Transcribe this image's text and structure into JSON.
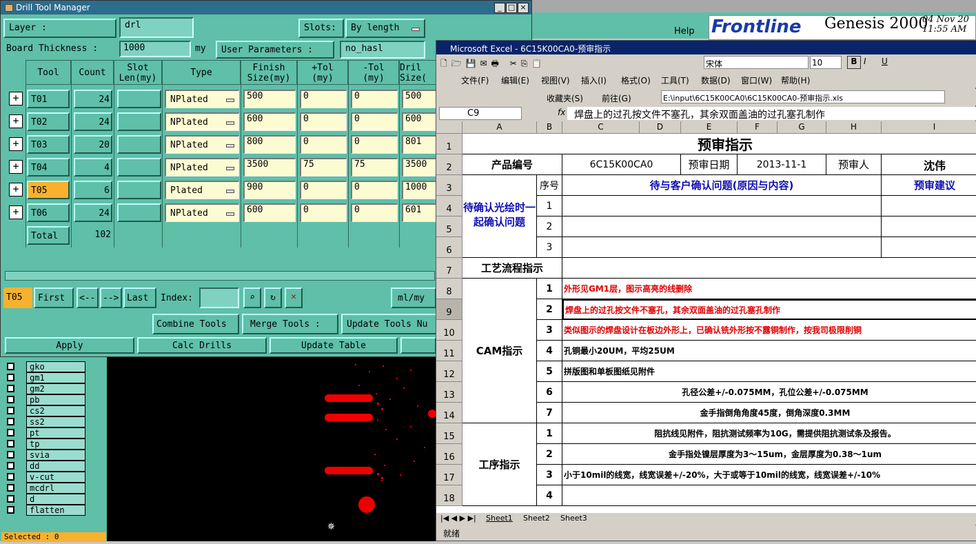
{
  "genesis": {
    "help": "Help",
    "brand": "Frontline",
    "product": "Genesis 2000",
    "date": "04 Nov 20",
    "time": "11:55 AM"
  },
  "drill": {
    "title": "Drill Tool Manager",
    "layer_label": "Layer           :",
    "layer_value": "drl",
    "slots_label": "Slots:",
    "slots_value": "By length",
    "board_label": "Board Thickness :",
    "board_value": "1000",
    "board_unit": "my",
    "userparam_label": "User Parameters :",
    "userparam_value": "no_hasl",
    "headers": [
      "Tool",
      "Count",
      "Slot\nLen(my)",
      "Type",
      "Finish\nSize(my)",
      "+Tol\n(my)",
      "-Tol\n(my)",
      "Dril\nSize("
    ],
    "rows": [
      {
        "tool": "T01",
        "count": "24",
        "type": "NPlated",
        "finish": "500",
        "ptol": "0",
        "mtol": "0",
        "drill": "500"
      },
      {
        "tool": "T02",
        "count": "24",
        "type": "NPlated",
        "finish": "600",
        "ptol": "0",
        "mtol": "0",
        "drill": "600"
      },
      {
        "tool": "T03",
        "count": "20",
        "type": "NPlated",
        "finish": "800",
        "ptol": "0",
        "mtol": "0",
        "drill": "801"
      },
      {
        "tool": "T04",
        "count": "4",
        "type": "NPlated",
        "finish": "3500",
        "ptol": "75",
        "mtol": "75",
        "drill": "3500"
      },
      {
        "tool": "T05",
        "count": "6",
        "type": "Plated",
        "finish": "900",
        "ptol": "0",
        "mtol": "0",
        "drill": "1000"
      },
      {
        "tool": "T06",
        "count": "24",
        "type": "NPlated",
        "finish": "600",
        "ptol": "0",
        "mtol": "0",
        "drill": "601"
      }
    ],
    "total_label": "Total",
    "total_value": "102",
    "current": "T05",
    "first": "First",
    "prev": "<--",
    "next": "-->",
    "last": "Last",
    "index_label": "Index:",
    "unit_btn": "ml/my",
    "combine": "Combine Tools",
    "merge": "Merge Tools :",
    "update_nu": "Update Tools Nu",
    "apply": "Apply",
    "calc": "Calc Drills",
    "update_table": "Update Table",
    "layers": [
      "gko",
      "gm1",
      "gm2",
      "pb",
      "cs2",
      "ss2",
      "pt",
      "tp",
      "svia",
      "dd",
      "v-cut",
      "mcdrl",
      "d",
      "flatten"
    ],
    "selected": "Selected : 0"
  },
  "excel": {
    "title": "Microsoft Excel - 6C15K00CA0-预审指示",
    "menu": [
      "文件(F)",
      "编辑(E)",
      "视图(V)",
      "插入(I)",
      "格式(O)",
      "工具(T)",
      "数据(D)",
      "窗口(W)",
      "帮助(H)"
    ],
    "font": "宋体",
    "size": "10",
    "favorites": "收藏夹(S)",
    "goto": "前往(G)",
    "path": "E:\\input\\6C15K00CA0\\6C15K00CA0-预审指示.xls",
    "cellref": "C9",
    "formula": "焊盘上的过孔按文件不塞孔，其余双面盖油的过孔塞孔制作",
    "cols": [
      "A",
      "B",
      "C",
      "D",
      "E",
      "F",
      "G",
      "H",
      "I"
    ],
    "rownums": [
      "1",
      "2",
      "3",
      "4",
      "5",
      "6",
      "7",
      "8",
      "9",
      "10",
      "11",
      "12",
      "13",
      "14",
      "15",
      "16",
      "17",
      "18"
    ],
    "sheet_title": "预审指示",
    "prod_label": "产品编号",
    "prod_value": "6C15K00CA0",
    "date_label": "预审日期",
    "date_value": "2013-11-1",
    "reviewer_label": "预审人",
    "reviewer_value": "沈伟",
    "seq": "序号",
    "issue_header": "待与客户确认问题(原因与内容)",
    "suggest_header": "预审建议",
    "confirm_label": "待确认光绘时一起确认问题",
    "process_label": "工艺流程指示",
    "cam_label": "CAM指示",
    "op_label": "工序指示",
    "cam_items": [
      "外形见GM1层，图示高亮的线删除",
      "焊盘上的过孔按文件不塞孔，其余双面盖油的过孔塞孔制作",
      "类似图示的焊盘设计在板边外形上，已确认铣外形按不露铜制作，按我司极限削铜",
      "孔铜最小20UM，平均25UM",
      "拼版图和单板图纸见附件",
      "孔径公差+/-0.075MM，孔位公差+/-0.075MM",
      "金手指倒角角度45度，倒角深度0.3MM"
    ],
    "op_items": [
      "阻抗线见附件，阻抗测试频率为10G，需提供阻抗测试条及报告。",
      "金手指处镍层厚度为3～15um，金层厚度为0.38～1um",
      "小于10mil的线宽，线宽误差+/-20%，大于或等于10mil的线宽，线宽误差+/-10%",
      ""
    ],
    "sheets": [
      "Sheet1",
      "Sheet2",
      "Sheet3"
    ],
    "status": "就绪"
  }
}
